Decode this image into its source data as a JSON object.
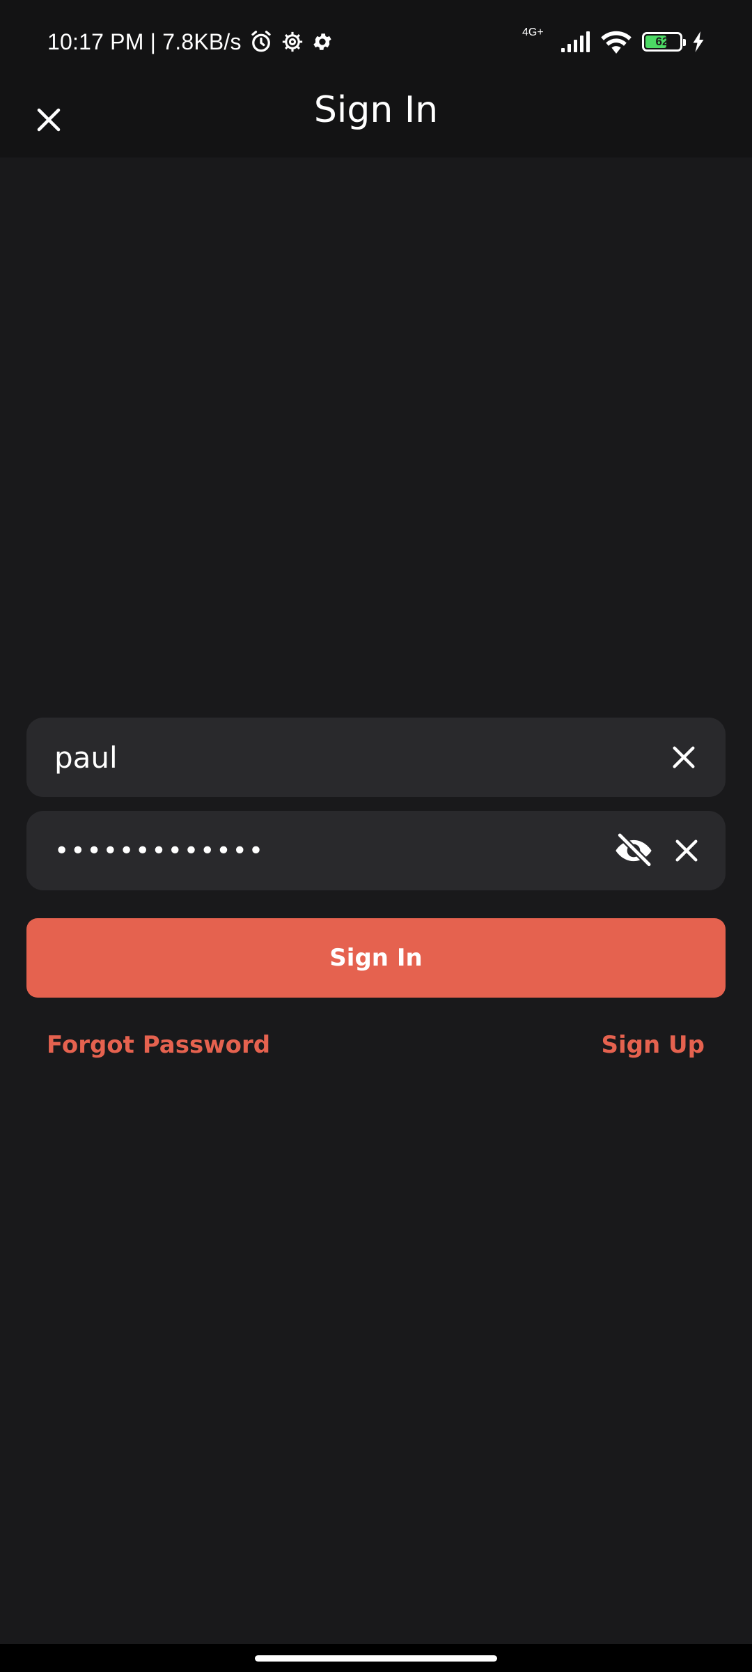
{
  "status_bar": {
    "time_speed": "10:17 PM | 7.8KB/s",
    "network_type": "4G+",
    "battery_level": "62",
    "battery_percent": 62,
    "icons": [
      "alarm-icon",
      "gear-outline-icon",
      "gear-icon",
      "signal-icon",
      "wifi-icon",
      "battery-icon",
      "charging-icon"
    ]
  },
  "app_bar": {
    "title": "Sign In",
    "close_icon": "close-icon"
  },
  "form": {
    "username": {
      "value": "paul",
      "clear_icon": "close-icon"
    },
    "password": {
      "value": "•••••••••••••",
      "visibility_icon": "eye-off-icon",
      "clear_icon": "close-icon"
    },
    "submit_label": "Sign In",
    "forgot_password_label": "Forgot Password",
    "sign_up_label": "Sign Up"
  },
  "colors": {
    "background": "#19191b",
    "app_bar": "#131314",
    "field": "#29292c",
    "accent": "#e5624f",
    "text": "#ffffff"
  }
}
